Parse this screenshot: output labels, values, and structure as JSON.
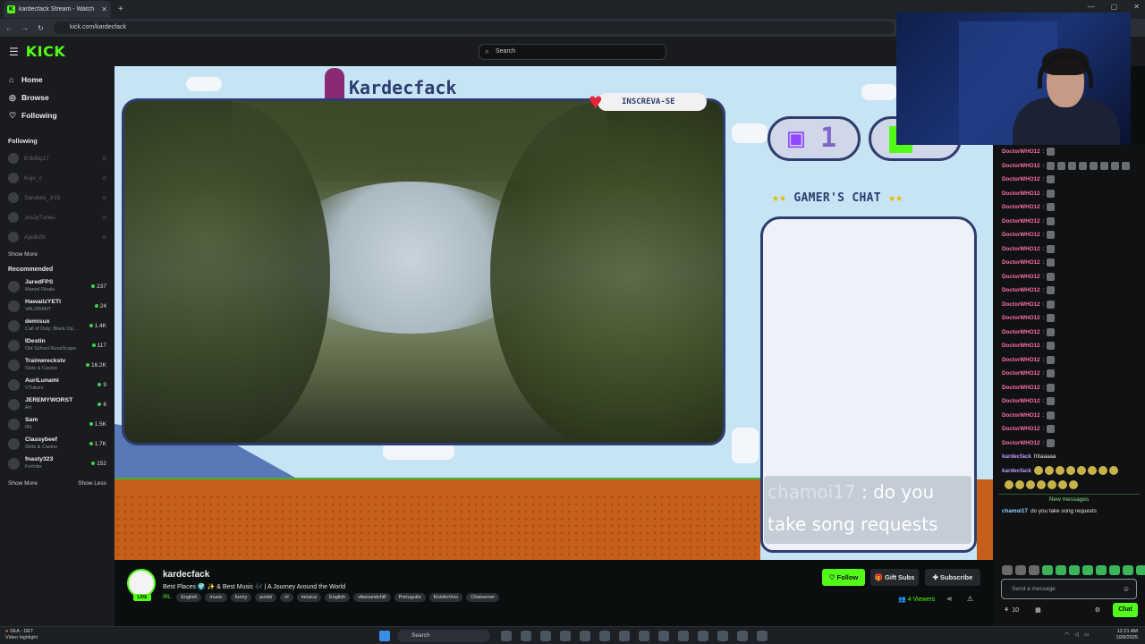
{
  "browser": {
    "tab_title": "kardecfack Stream - Watch",
    "new_tab": "+",
    "url": "kick.com/kardecfack"
  },
  "header": {
    "logo": "KICK",
    "search_placeholder": "Search"
  },
  "sidebar": {
    "nav": [
      {
        "label": "Home",
        "icon": "home-icon"
      },
      {
        "label": "Browse",
        "icon": "compass-icon"
      },
      {
        "label": "Following",
        "icon": "heart-icon"
      }
    ],
    "following_title": "Following",
    "following": [
      "ErikBig17",
      "Kujo_c",
      "Sarutobi_Jr15",
      "Jos3yTunes",
      "Apollo5l"
    ],
    "show_more_1": "Show More",
    "recommended_title": "Recommended",
    "recommended": [
      {
        "name": "JaredFPS",
        "category": "Marvel Rivals",
        "viewers": "237"
      },
      {
        "name": "HawaiizYETI",
        "category": "VALORANT",
        "viewers": "24"
      },
      {
        "name": "demisux",
        "category": "Call of Duty: Black Op...",
        "viewers": "1.4K"
      },
      {
        "name": "IDestin",
        "category": "Old School RuneScape",
        "viewers": "117"
      },
      {
        "name": "Trainwreckstv",
        "category": "Slots & Casino",
        "viewers": "16.2K"
      },
      {
        "name": "AuriLunami",
        "category": "VTubers",
        "viewers": "9"
      },
      {
        "name": "JEREMYWORST",
        "category": "Art",
        "viewers": "6"
      },
      {
        "name": "Sam",
        "category": "IRL",
        "viewers": "1.5K"
      },
      {
        "name": "Classybeef",
        "category": "Slots & Casino",
        "viewers": "1.7K"
      },
      {
        "name": "fnasty323",
        "category": "Fortnite",
        "viewers": "152"
      }
    ],
    "show_more_2": "Show More",
    "show_less": "Show Less"
  },
  "stream": {
    "overlay_title": "Kardecfack",
    "subscribe_badge": "INSCREVA-SE",
    "twitch_count": "1",
    "gamers_chat": "GAMER'S CHAT",
    "overlay_msg_user": "chamoi17",
    "overlay_msg_text": ": do you take song requests"
  },
  "channel": {
    "name": "kardecfack",
    "live_badge": "LIVE",
    "title": "Best Places 🌍 ✨ & Best Music 🎶 | A Journey Around the World",
    "category": "IRL",
    "tags": [
      "English",
      "music",
      "funny",
      "polski",
      "irl",
      "música",
      "English",
      "vibesandchill",
      "Português",
      "KickAoVivo",
      "Chatserver"
    ],
    "follow": "Follow",
    "gift_subs": "Gift Subs",
    "subscribe": "Subscribe",
    "viewers": "4 Viewers"
  },
  "chat": {
    "spam_user": "DoctorWHO12",
    "spam_count": 22,
    "kardec_msg_1": "fritaaaaa",
    "kardec_user": "kardecfack",
    "new_messages": "New messages",
    "last_user": "chamoi17",
    "last_text": "do you take song requests",
    "input_placeholder": "Send a message",
    "points": "10",
    "chat_button": "Chat"
  },
  "taskbar": {
    "weather_temp": "SEA - DET",
    "weather_note": "Video highlight",
    "search": "Search",
    "time": "12:21 AM",
    "date": "10/9/2025"
  }
}
